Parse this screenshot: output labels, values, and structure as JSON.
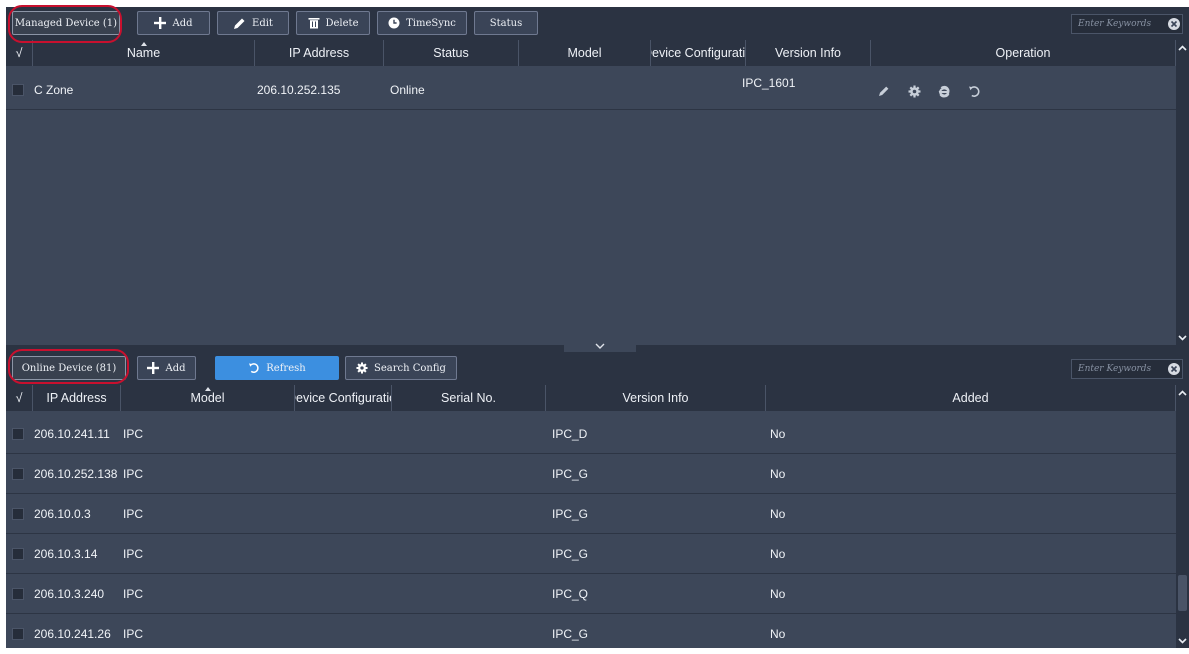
{
  "managed": {
    "title": "Managed Device (1)",
    "toolbar": {
      "add": "Add",
      "edit": "Edit",
      "delete": "Delete",
      "timesync": "TimeSync",
      "status": "Status"
    },
    "search_placeholder": "Enter Keywords",
    "columns": {
      "check": "√",
      "name": "Name",
      "ip": "IP Address",
      "status": "Status",
      "model": "Model",
      "config": "Device Configuration",
      "version": "Version Info",
      "operation": "Operation"
    },
    "rows": [
      {
        "name": "C Zone",
        "ip": "206.10.252.135",
        "status": "Online",
        "model": "",
        "config": "",
        "version": "IPC_1601"
      }
    ],
    "operation_icons": [
      "edit-icon",
      "settings-icon",
      "browser-icon",
      "refresh-icon"
    ]
  },
  "online": {
    "title": "Online Device (81)",
    "toolbar": {
      "add": "Add",
      "refresh": "Refresh",
      "search_config": "Search Config"
    },
    "search_placeholder": "Enter Keywords",
    "columns": {
      "check": "√",
      "ip": "IP Address",
      "model": "Model",
      "config": "Device Configuration",
      "serial": "Serial No.",
      "version": "Version Info",
      "added": "Added"
    },
    "rows": [
      {
        "ip": "206.10.241.11",
        "model": "IPC",
        "serial": "",
        "version": "IPC_D",
        "added": "No"
      },
      {
        "ip": "206.10.252.138",
        "model": "IPC",
        "serial": "",
        "version": "IPC_G",
        "added": "No"
      },
      {
        "ip": "206.10.0.3",
        "model": "IPC",
        "serial": "",
        "version": "IPC_G",
        "added": "No"
      },
      {
        "ip": "206.10.3.14",
        "model": "IPC",
        "serial": "",
        "version": "IPC_G",
        "added": "No"
      },
      {
        "ip": "206.10.3.240",
        "model": "IPC",
        "serial": "",
        "version": "IPC_Q",
        "added": "No"
      },
      {
        "ip": "206.10.241.26",
        "model": "IPC",
        "serial": "",
        "version": "IPC_G",
        "added": "No"
      }
    ]
  },
  "colors": {
    "panel_bg": "#3d4759",
    "toolbar_bg": "#2b3342",
    "accent_blue": "#3c8fe0",
    "highlight_red": "#c8102e"
  }
}
